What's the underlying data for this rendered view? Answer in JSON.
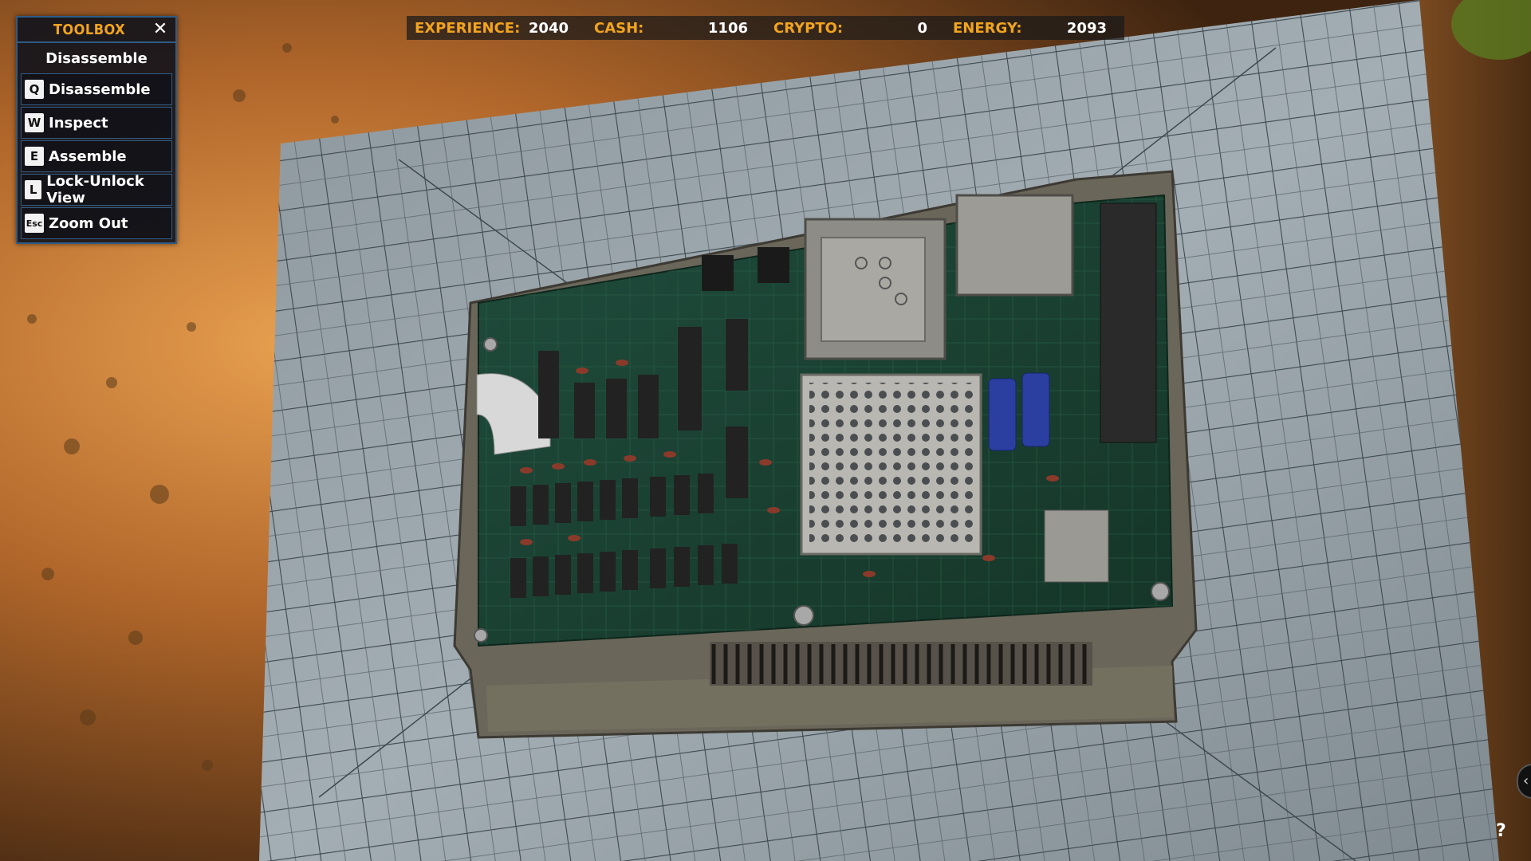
{
  "toolbox": {
    "title": "TOOLBOX",
    "mode": "Disassemble",
    "items": [
      {
        "key": "Q",
        "label": "Disassemble"
      },
      {
        "key": "W",
        "label": "Inspect"
      },
      {
        "key": "E",
        "label": "Assemble"
      },
      {
        "key": "L",
        "label": "Lock-Unlock View"
      },
      {
        "key": "Esc",
        "label": "Zoom Out"
      }
    ]
  },
  "stats": {
    "experience_label": "EXPERIENCE:",
    "experience_value": "2040",
    "cash_label": "CASH:",
    "cash_value": "1106",
    "crypto_label": "CRYPTO:",
    "crypto_value": "0",
    "energy_label": "ENERGY:",
    "energy_value": "2093"
  },
  "help": "?",
  "colors": {
    "accent": "#f2a41e",
    "panel_border": "#2f5c86",
    "pcb": "#1e4a3a",
    "mat": "#9aa7ae",
    "wood": "#c87a2e"
  },
  "icons": {
    "close": "close-icon",
    "help": "help-icon",
    "side_tab": "chevron-left-icon"
  }
}
